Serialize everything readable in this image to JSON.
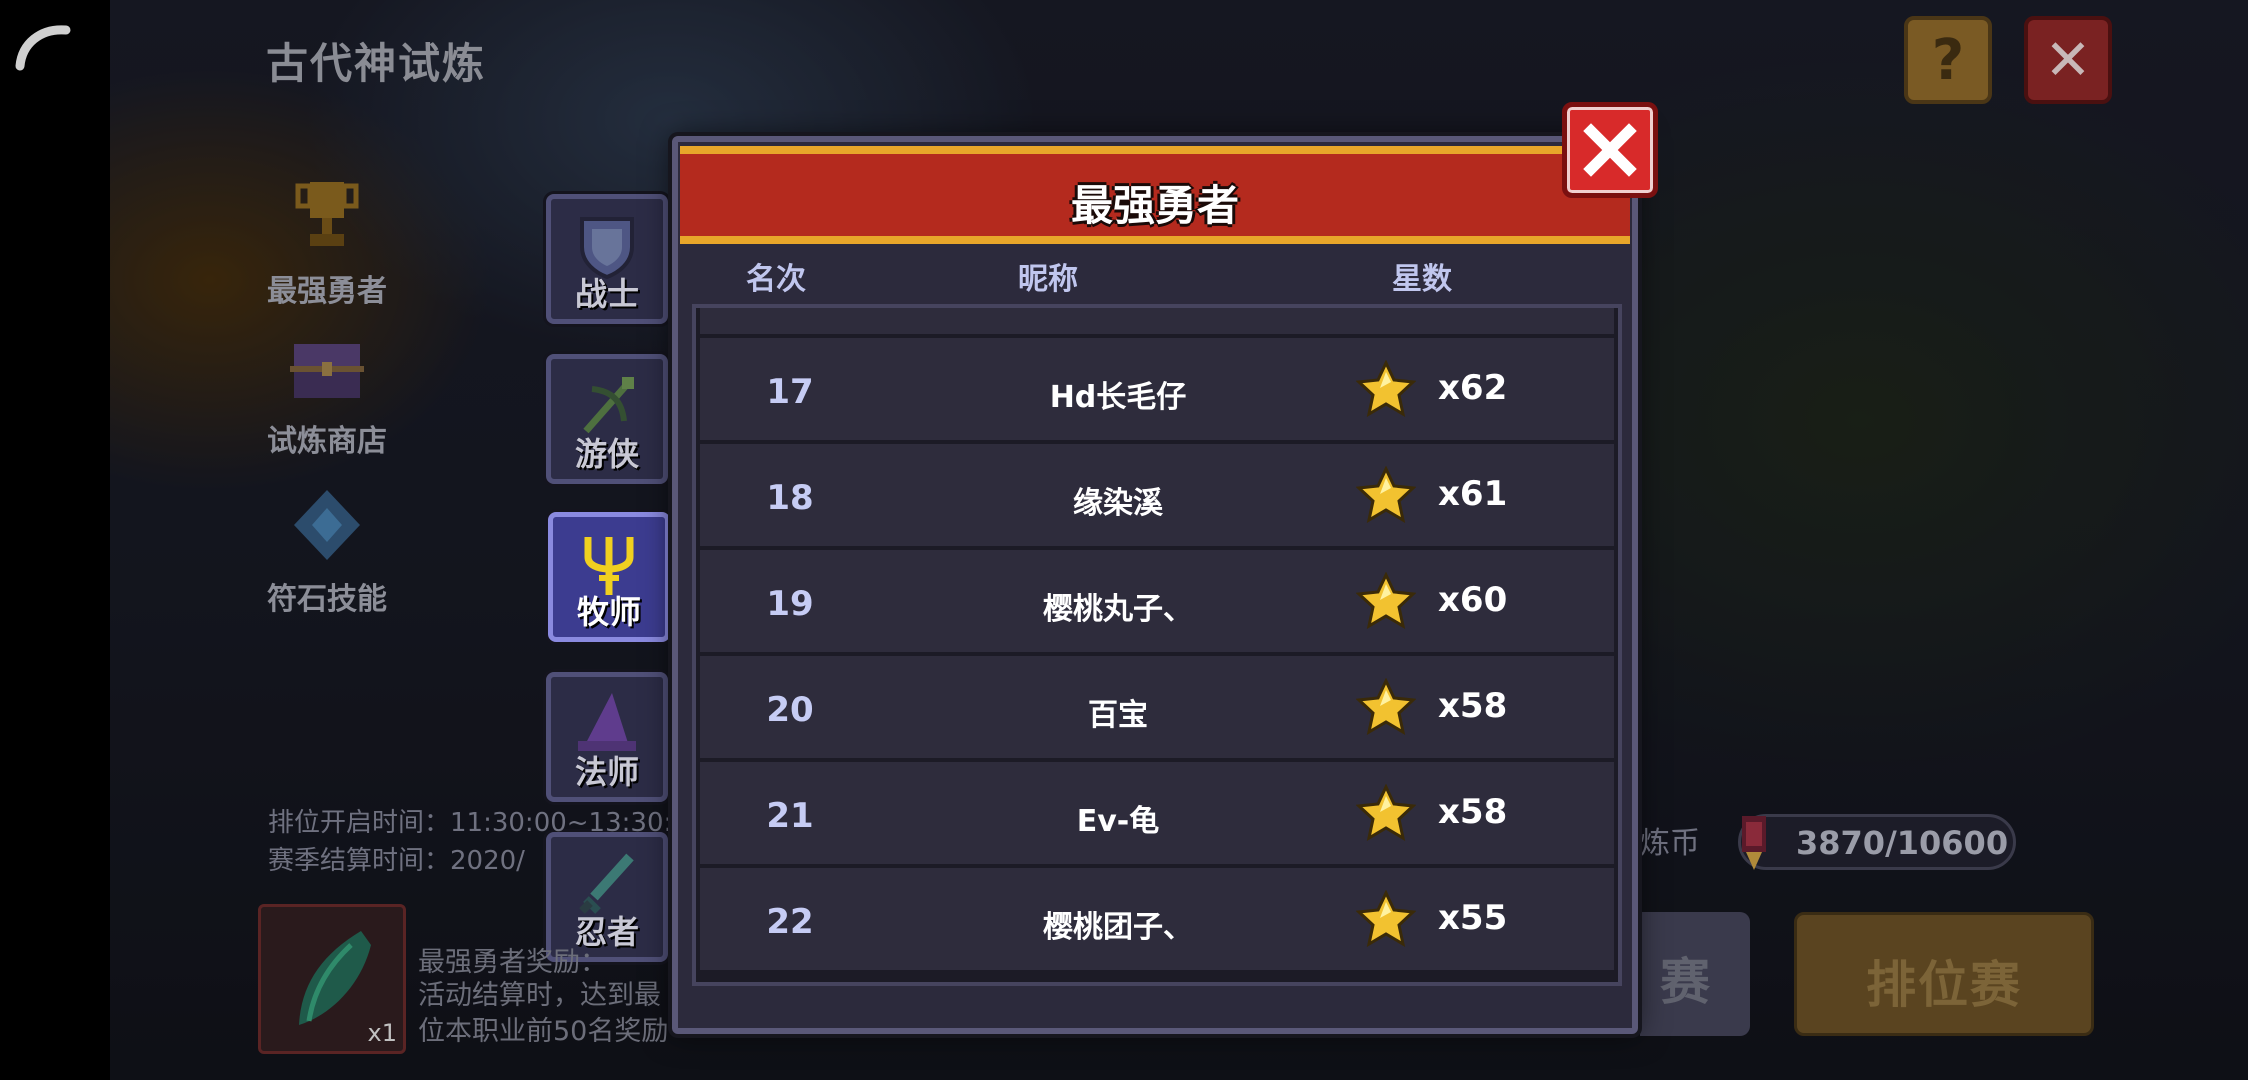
{
  "header": {
    "title": "古代神试炼",
    "help_label": "?",
    "close_label": "✕"
  },
  "side_menu": [
    {
      "label": "最强勇者",
      "icon": "trophy-icon"
    },
    {
      "label": "试炼商店",
      "icon": "chest-icon"
    },
    {
      "label": "符石技能",
      "icon": "rune-icon"
    }
  ],
  "class_tabs": [
    {
      "label": "战士",
      "icon": "shield-icon",
      "active": false
    },
    {
      "label": "游侠",
      "icon": "bow-icon",
      "active": false
    },
    {
      "label": "牧师",
      "icon": "trident-staff-icon",
      "active": true
    },
    {
      "label": "法师",
      "icon": "wizard-hat-icon",
      "active": false
    },
    {
      "label": "忍者",
      "icon": "dagger-icon",
      "active": false
    }
  ],
  "info": {
    "ranked_open": "排位开启时间：11:30:00~13:30:0",
    "season_settle": "赛季结算时间：2020/",
    "reward_title": "最强勇者奖励：",
    "reward_desc_line1": "活动结算时，达到最",
    "reward_desc_line2": "位本职业前50名奖励",
    "reward_count": "x1",
    "coin_label": "炼币",
    "coin_value": "3870/10600",
    "left_button_fragment": "赛",
    "ranked_button": "排位赛"
  },
  "modal": {
    "title": "最强勇者",
    "close_label": "✕",
    "columns": {
      "rank": "名次",
      "nickname": "昵称",
      "stars": "星数"
    },
    "rows": [
      {
        "rank": "17",
        "nickname": "Hd长毛仔",
        "stars": "x62"
      },
      {
        "rank": "18",
        "nickname": "缘染溪",
        "stars": "x61"
      },
      {
        "rank": "19",
        "nickname": "樱桃丸子、",
        "stars": "x60"
      },
      {
        "rank": "20",
        "nickname": "百宝",
        "stars": "x58"
      },
      {
        "rank": "21",
        "nickname": "Ev-龟",
        "stars": "x58"
      },
      {
        "rank": "22",
        "nickname": "樱桃团子、",
        "stars": "x55"
      }
    ]
  },
  "colors": {
    "header_red": "#b42a1e",
    "header_gold": "#e8a62a",
    "star_gold": "#f2c230",
    "active_tab": "#3c3c90"
  }
}
